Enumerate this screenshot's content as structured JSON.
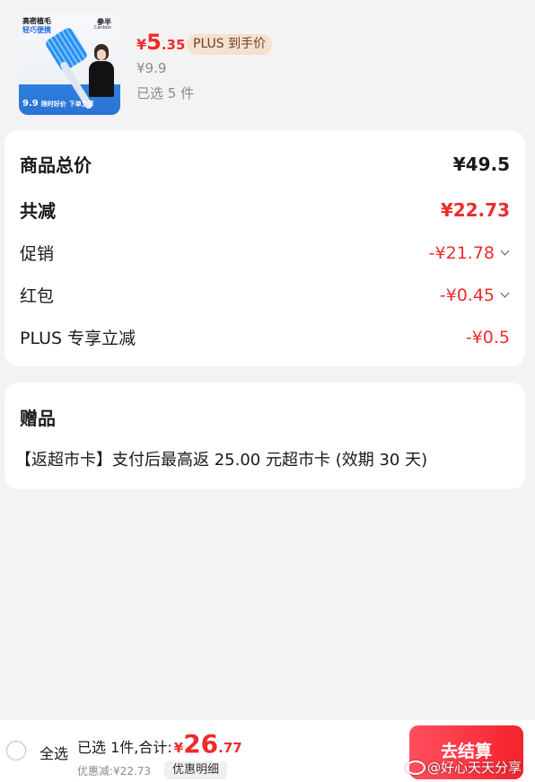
{
  "product": {
    "thumb": {
      "headline": "高密植毛",
      "subheadline": "轻巧便携",
      "brand": "参半",
      "brand_en": "Canbon",
      "bottom_price": "9.9",
      "bottom_tag": "限时好价",
      "bottom_cta": "下单立享"
    },
    "price_symbol": "¥",
    "price_int": "5",
    "price_dec": ".35",
    "plus_badge": "PLUS 到手价",
    "original_price": "¥9.9",
    "selected_count": "已选 5 件"
  },
  "summary": {
    "rows": [
      {
        "label": "商品总价",
        "value": "¥49.5"
      },
      {
        "label": "共减",
        "value": "¥22.73"
      },
      {
        "label": "促销",
        "value": "-¥21.78"
      },
      {
        "label": "红包",
        "value": "-¥0.45"
      },
      {
        "label": "PLUS 专享立减",
        "value": "-¥0.5"
      }
    ]
  },
  "gift": {
    "title": "赠品",
    "text": "【返超市卡】支付后最高返 25.00 元超市卡 (效期 30 天)"
  },
  "bottom": {
    "select_all": "全选",
    "total_prefix": "已选 1件,合计:",
    "total_symbol": "¥",
    "total_int": "26",
    "total_dec": ".77",
    "discount": "优惠减:¥22.73",
    "detail_button": "优惠明细",
    "checkout_button": "去结算"
  },
  "watermark": "@好心天天分享",
  "colors": {
    "accent_red": "#ef2b2b",
    "plus_badge_bg": "#f6e0cf",
    "background": "#f3f3f3"
  }
}
